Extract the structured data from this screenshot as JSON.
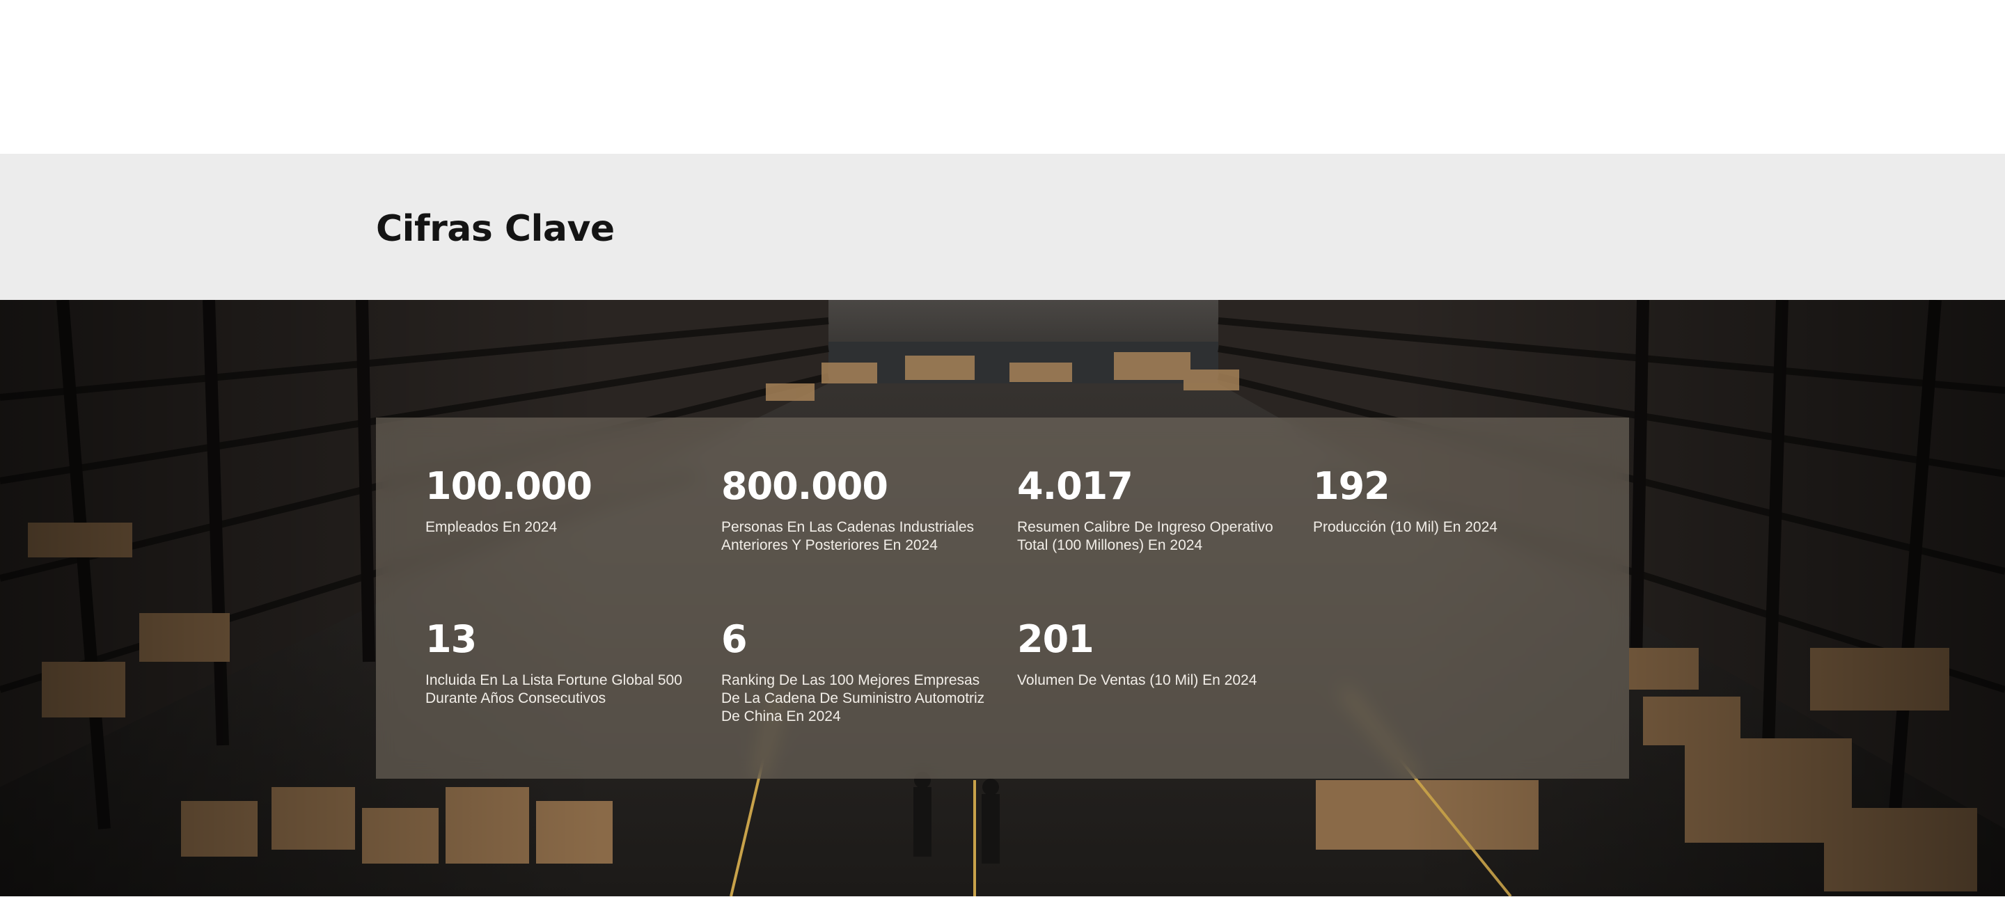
{
  "section": {
    "title": "Cifras Clave"
  },
  "stats": [
    {
      "value": "100.000",
      "label": "Empleados En 2024"
    },
    {
      "value": "800.000",
      "label": "Personas En Las Cadenas Industriales Anteriores Y Posteriores En 2024"
    },
    {
      "value": "4.017",
      "label": "Resumen Calibre De Ingreso Operativo Total (100 Millones) En 2024"
    },
    {
      "value": "192",
      "label": "Producción (10 Mil) En 2024"
    },
    {
      "value": "13",
      "label": "Incluida En La Lista Fortune Global 500 Durante Años Consecutivos"
    },
    {
      "value": "6",
      "label": "Ranking De Las 100 Mejores Empresas De La Cadena De Suministro Automotriz De China En 2024"
    },
    {
      "value": "201",
      "label": "Volumen De Ventas (10 Mil) En 2024"
    }
  ],
  "colors": {
    "title_band": "#ececec",
    "title_text": "#141414",
    "stat_text": "#ffffff",
    "panel": "#807668"
  }
}
